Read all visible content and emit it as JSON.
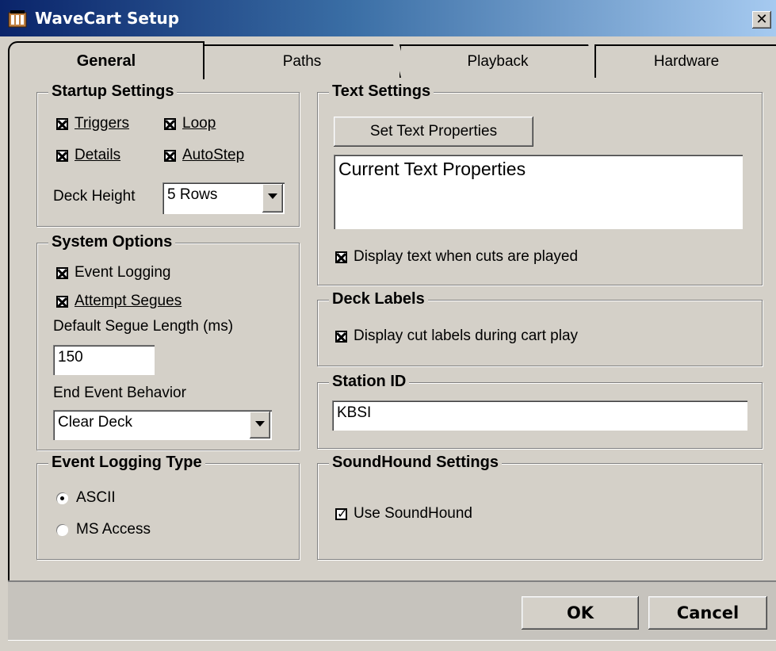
{
  "window": {
    "title": "WaveCart Setup",
    "icons": {
      "app": "wavecart-app-icon",
      "close": "close-icon"
    }
  },
  "tabs": [
    {
      "label": "General",
      "active": true
    },
    {
      "label": "Paths",
      "active": false
    },
    {
      "label": "Playback",
      "active": false
    },
    {
      "label": "Hardware",
      "active": false
    }
  ],
  "startup": {
    "title": "Startup Settings",
    "triggers_label": "Triggers",
    "triggers_checked": true,
    "loop_label": "Loop",
    "loop_checked": true,
    "details_label": "Details",
    "details_checked": true,
    "autostep_label": "AutoStep",
    "autostep_checked": true,
    "deck_height_label": "Deck Height",
    "deck_height_value": "5 Rows"
  },
  "system": {
    "title": "System Options",
    "event_logging_label": "Event Logging",
    "event_logging_checked": true,
    "attempt_segues_label": "Attempt Segues",
    "attempt_segues_checked": true,
    "segue_length_label": "Default Segue Length (ms)",
    "segue_length_value": "150",
    "end_event_label": "End Event Behavior",
    "end_event_value": "Clear Deck"
  },
  "logging_type": {
    "title": "Event Logging Type",
    "options": [
      {
        "label": "ASCII",
        "selected": true
      },
      {
        "label": "MS Access",
        "selected": false
      }
    ]
  },
  "text_settings": {
    "title": "Text Settings",
    "set_button": "Set Text Properties",
    "preview_text": "Current Text Properties",
    "display_label": "Display text when cuts are played",
    "display_checked": true
  },
  "deck_labels": {
    "title": "Deck Labels",
    "display_label": "Display cut labels during cart play",
    "display_checked": true
  },
  "station": {
    "title": "Station ID",
    "value": "KBSI"
  },
  "soundhound": {
    "title": "SoundHound Settings",
    "use_label": "Use SoundHound",
    "use_checked": true
  },
  "footer": {
    "ok_label": "OK",
    "cancel_label": "Cancel"
  },
  "colors": {
    "titlebar_start": "#0a246a",
    "titlebar_end": "#a6caf0",
    "face": "#d4d0c8"
  }
}
